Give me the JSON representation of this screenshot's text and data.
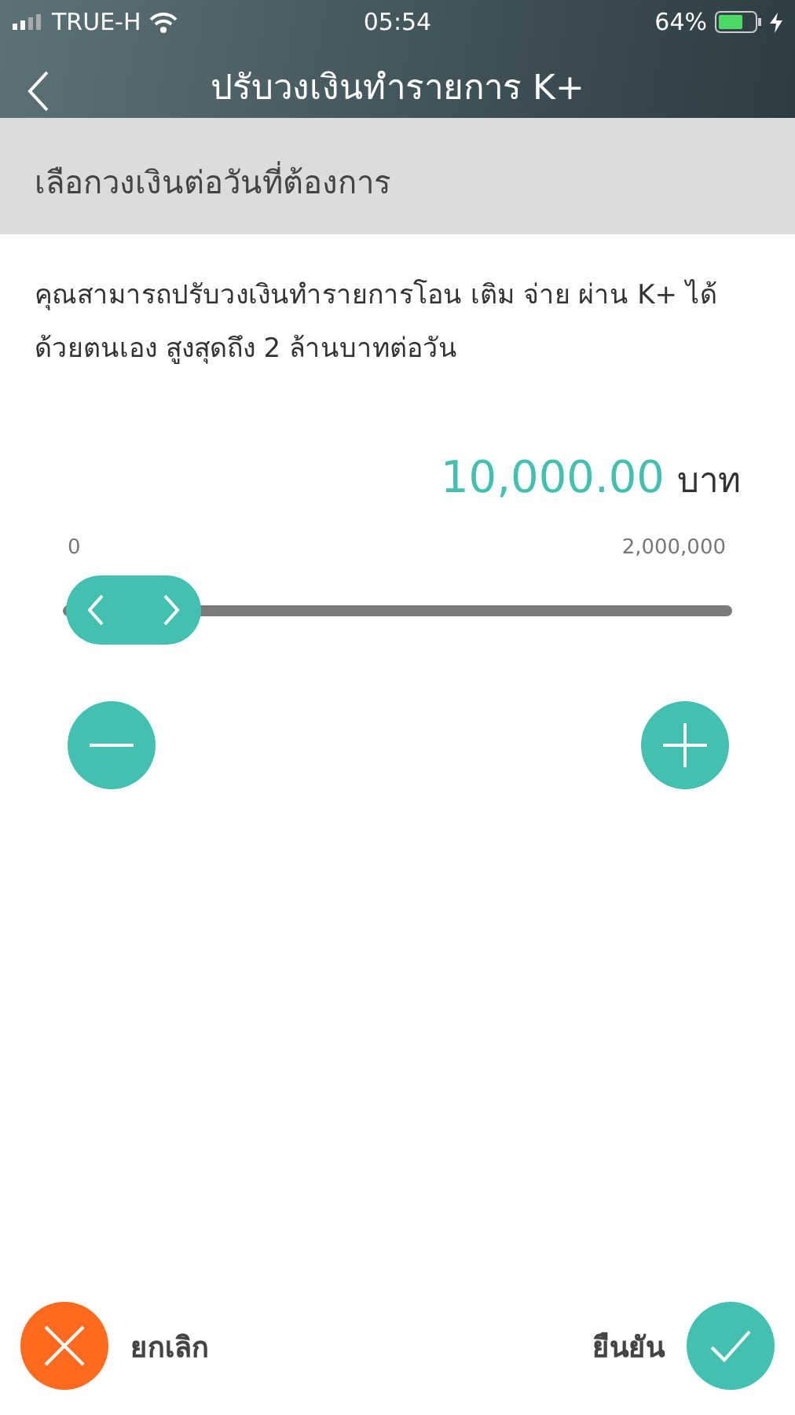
{
  "status_bar": {
    "carrier": "TRUE-H",
    "time": "05:54",
    "battery": "64%"
  },
  "nav": {
    "title": "ปรับวงเงินทำรายการ K+"
  },
  "section": {
    "title": "เลือกวงเงินต่อวันที่ต้องการ"
  },
  "description": "คุณสามารถปรับวงเงินทำรายการโอน เติม จ่าย ผ่าน K+ ได้ด้วยตนเอง สูงสุดถึง 2 ล้านบาทต่อวัน",
  "amount": {
    "value": "10,000.00",
    "unit": "บาท"
  },
  "slider": {
    "min_label": "0",
    "max_label": "2,000,000",
    "level": 0.005
  },
  "footer": {
    "cancel": "ยกเลิก",
    "confirm": "ยืนยัน"
  }
}
